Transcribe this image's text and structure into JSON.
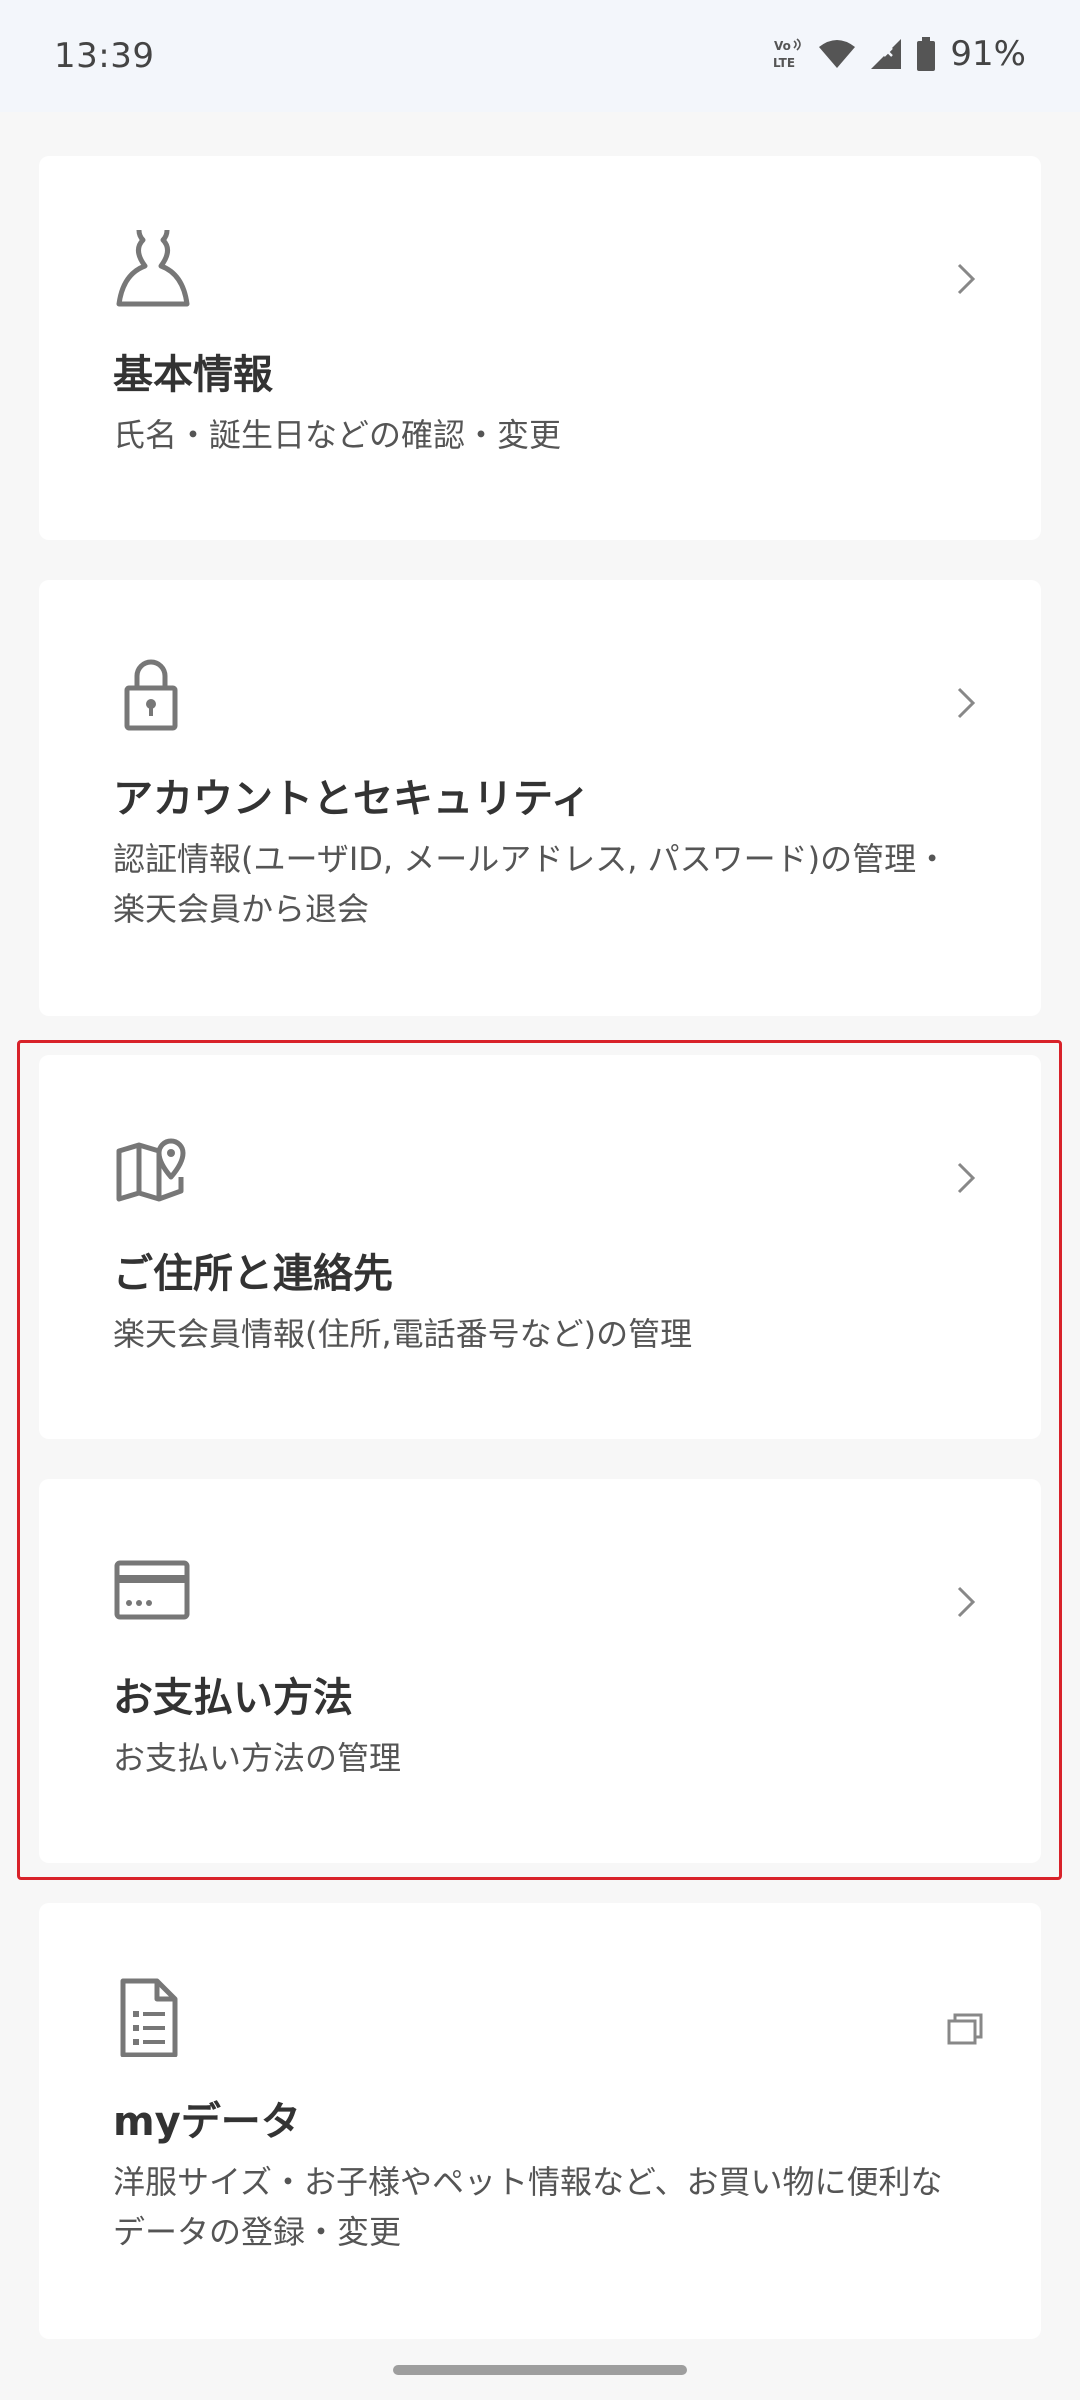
{
  "status_bar": {
    "time": "13:39",
    "battery": "91%",
    "icons": [
      "volte-icon",
      "wifi-icon",
      "signal-icon",
      "battery-icon"
    ]
  },
  "cards": [
    {
      "title": "基本情報",
      "description": "氏名・誕生日などの確認・変更",
      "icon": "person-icon",
      "action_icon": "chevron-right-icon"
    },
    {
      "title": "アカウントとセキュリティ",
      "description": "認証情報(ユーザID, メールアドレス, パスワード)の管理・楽天会員から退会",
      "icon": "lock-icon",
      "action_icon": "chevron-right-icon"
    },
    {
      "title": "ご住所と連絡先",
      "description": "楽天会員情報(住所,電話番号など)の管理",
      "icon": "map-pin-icon",
      "action_icon": "chevron-right-icon"
    },
    {
      "title": "お支払い方法",
      "description": "お支払い方法の管理",
      "icon": "credit-card-icon",
      "action_icon": "chevron-right-icon"
    },
    {
      "title": "myデータ",
      "description": "洋服サイズ・お子様やペット情報など、お買い物に便利なデータの登録・変更",
      "icon": "document-icon",
      "action_icon": "external-window-icon"
    }
  ],
  "colors": {
    "background": "#f7f7f7",
    "card": "#ffffff",
    "highlight": "#d8222a",
    "icon": "#777777",
    "title": "#333333",
    "description": "#555555"
  }
}
